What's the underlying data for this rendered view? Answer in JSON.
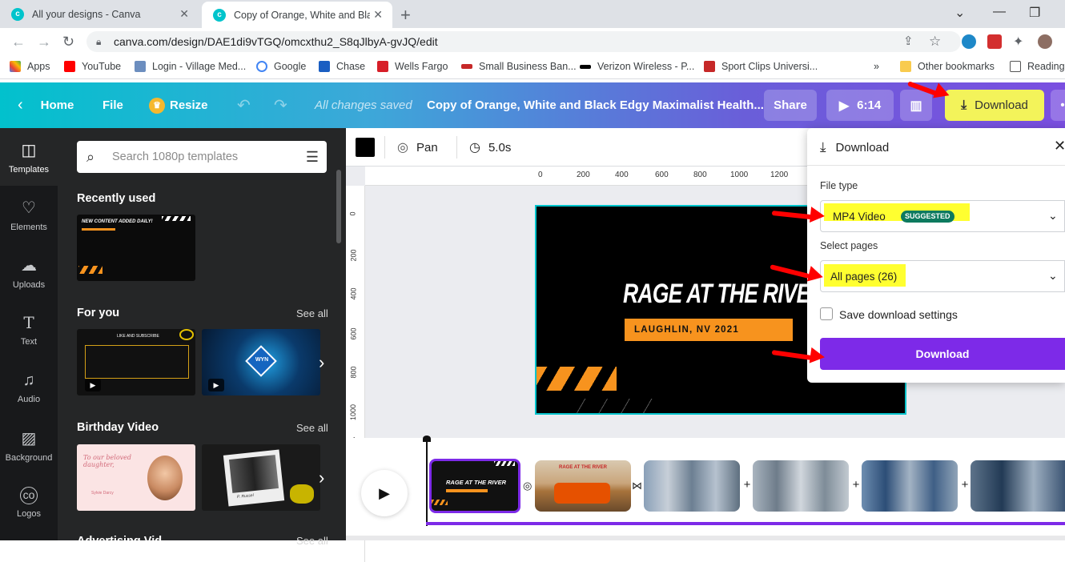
{
  "browser": {
    "tabs": [
      {
        "title": "All your designs - Canva"
      },
      {
        "title": "Copy of Orange, White and Black"
      }
    ],
    "url": "canva.com/design/DAE1di9vTGQ/omcxthu2_S8qJlbyA-gvJQ/edit",
    "bookmarks": [
      "Apps",
      "YouTube",
      "Login - Village Med...",
      "Google",
      "Chase",
      "Wells Fargo",
      "Small Business Ban...",
      "Verizon Wireless - P...",
      "Sport Clips Universi...",
      "»",
      "Other bookmarks",
      "Reading"
    ]
  },
  "header": {
    "home": "Home",
    "file": "File",
    "resize": "Resize",
    "saved": "All changes saved",
    "title": "Copy of Orange, White and Black Edgy Maximalist Health...",
    "share": "Share",
    "duration": "6:14",
    "download": "Download",
    "more": "•"
  },
  "rail": {
    "items": [
      "Templates",
      "Elements",
      "Uploads",
      "Text",
      "Audio",
      "Background",
      "Logos"
    ]
  },
  "panel": {
    "search_placeholder": "Search 1080p templates",
    "recently_used": "Recently used",
    "for_you": "For you",
    "birthday": "Birthday Video",
    "see_all": "See all",
    "partial_heading": "Advertising Vid",
    "thumb_texts": {
      "recent": "NEW CONTENT ADDED DAILY!",
      "foryou1": "LIKE AND SUBSCRIBE",
      "foryou2": "WYN",
      "bday1": "To our beloved daughter,",
      "bday2": "Sylvie Darcy",
      "bday3": "P. Russel"
    }
  },
  "toolbar": {
    "pan": "Pan",
    "duration": "5.0s",
    "ruler_top": [
      "0",
      "200",
      "400",
      "600",
      "800",
      "1000",
      "1200"
    ],
    "ruler_left": [
      "0",
      "200",
      "400",
      "600",
      "800",
      "1000"
    ]
  },
  "canvas": {
    "headline": "RAGE AT THE RIVER",
    "subline": "LAUGHLIN, NV 2021"
  },
  "timeline": {
    "first_clip_title": "RAGE AT THE RIVER",
    "clip2_text": "RAGE AT THE RIVER"
  },
  "download_panel": {
    "title": "Download",
    "file_type_label": "File type",
    "file_type_value": "MP4 Video",
    "suggested": "SUGGESTED",
    "pages_label": "Select pages",
    "pages_value": "All pages (26)",
    "save_settings": "Save download settings",
    "download_button": "Download"
  },
  "colors": {
    "purple": "#7d2ae8",
    "highlight": "#ffff30",
    "annotation_red": "#ff0000",
    "canva_teal": "#00c4cc",
    "orange": "#f7931e"
  }
}
